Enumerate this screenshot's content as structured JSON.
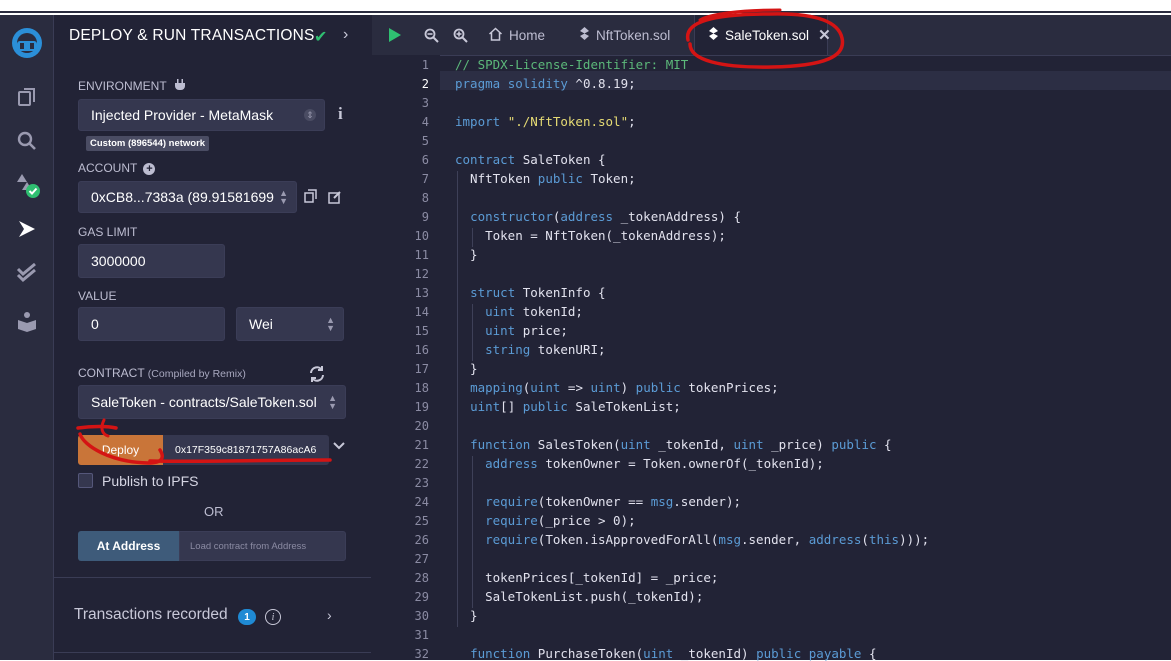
{
  "app_icons": [
    "remix-logo-icon",
    "file-explorer-icon",
    "search-icon",
    "solidity-compiler-icon",
    "deploy-run-icon",
    "test-check-icon",
    "learn-icon"
  ],
  "panel": {
    "title": "DEPLOY & RUN TRANSACTIONS",
    "environment_label": "ENVIRONMENT",
    "environment_value": "Injected Provider - MetaMask",
    "network_badge": "Custom (896544) network",
    "account_label": "ACCOUNT",
    "account_value": "0xCB8...7383a (89.91581699",
    "gas_limit_label": "GAS LIMIT",
    "gas_limit_value": "3000000",
    "value_label": "VALUE",
    "value_amount": "0",
    "value_unit": "Wei",
    "contract_label": "CONTRACT",
    "contract_sublabel": "(Compiled by Remix)",
    "contract_value": "SaleToken - contracts/SaleToken.sol",
    "deploy_label": "Deploy",
    "deploy_args": "0x17F359c81871757A86acA6",
    "publish_label": "Publish to IPFS",
    "or_label": "OR",
    "at_address_label": "At Address",
    "at_address_placeholder": "Load contract from Address",
    "transactions_label": "Transactions recorded",
    "transactions_count": "1"
  },
  "tabs": {
    "home": "Home",
    "file1": "NftToken.sol",
    "file2": "SaleToken.sol"
  },
  "code_lines": [
    "// SPDX-License-Identifier: MIT",
    "pragma solidity ^0.8.19;",
    "",
    "import \"./NftToken.sol\";",
    "",
    "contract SaleToken {",
    "  NftToken public Token;",
    "",
    "  constructor(address _tokenAddress) {",
    "    Token = NftToken(_tokenAddress);",
    "  }",
    "",
    "  struct TokenInfo {",
    "    uint tokenId;",
    "    uint price;",
    "    string tokenURI;",
    "  }",
    "  mapping(uint => uint) public tokenPrices;",
    "  uint[] public SaleTokenList;",
    "",
    "  function SalesToken(uint _tokenId, uint _price) public {",
    "    address tokenOwner = Token.ownerOf(_tokenId);",
    "",
    "    require(tokenOwner == msg.sender);",
    "    require(_price > 0);",
    "    require(Token.isApprovedForAll(msg.sender, address(this)));",
    "",
    "    tokenPrices[_tokenId] = _price;",
    "    SaleTokenList.push(_tokenId);",
    "  }",
    "",
    "  function PurchaseToken(uint _tokenId) public payable {"
  ],
  "colors": {
    "keyword": "#5b9bd5",
    "comment": "#5cb87a",
    "string": "#e6db74",
    "annotation": "#d41414",
    "deploy": "#c97539"
  }
}
